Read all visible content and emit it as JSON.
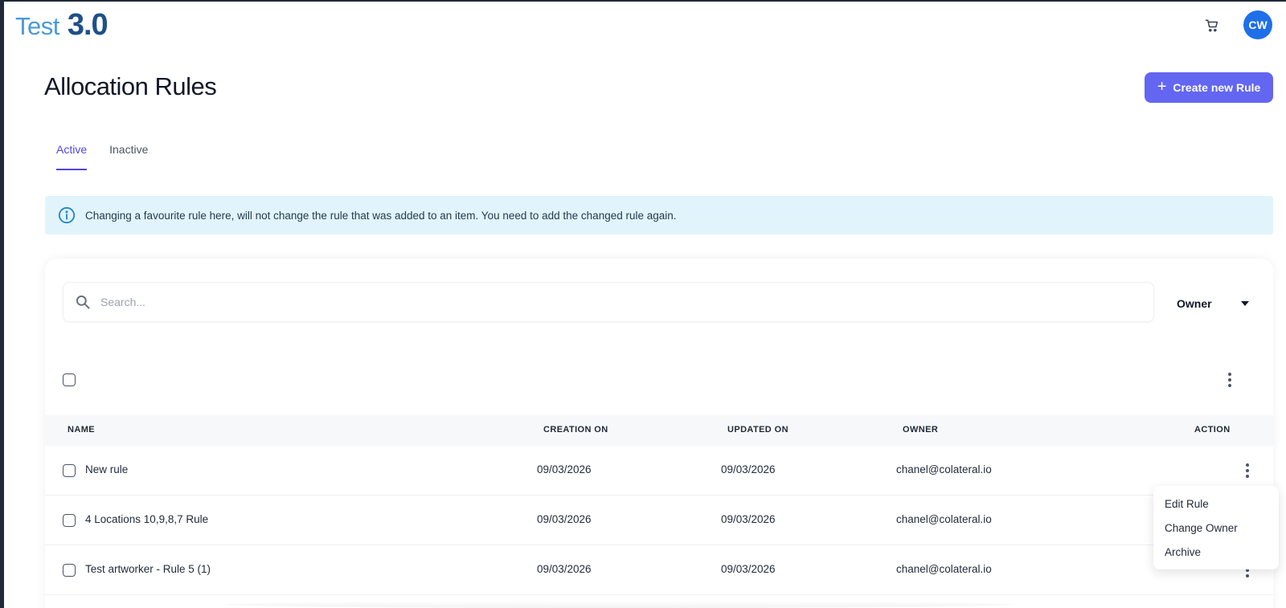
{
  "header": {
    "logo_text": "Test",
    "logo_version": "3.0",
    "avatar_initials": "CW",
    "cart_icon": "cart-icon"
  },
  "page": {
    "title": "Allocation Rules",
    "create_button_label": "Create new Rule"
  },
  "tabs": [
    {
      "label": "Active",
      "active": true
    },
    {
      "label": "Inactive",
      "active": false
    }
  ],
  "info_banner": {
    "icon": "info-icon",
    "text": "Changing a favourite rule here, will not change the rule that was added to an item. You need to add the changed rule again."
  },
  "search": {
    "placeholder": "Search...",
    "value": ""
  },
  "owner_filter": {
    "label": "Owner"
  },
  "table": {
    "columns": [
      "NAME",
      "CREATION ON",
      "UPDATED ON",
      "OWNER",
      "ACTION"
    ],
    "rows": [
      {
        "name": "New rule",
        "created": "09/03/2026",
        "updated": "09/03/2026",
        "owner": "chanel@colateral.io"
      },
      {
        "name": "4 Locations 10,9,8,7 Rule",
        "created": "09/03/2026",
        "updated": "09/03/2026",
        "owner": "chanel@colateral.io"
      },
      {
        "name": "Test artworker - Rule 5 (1)",
        "created": "09/03/2026",
        "updated": "09/03/2026",
        "owner": "chanel@colateral.io"
      }
    ]
  },
  "action_menu": {
    "items": [
      "Edit Rule",
      "Change Owner",
      "Archive"
    ]
  },
  "colors": {
    "accent": "#6366f1",
    "tab_active": "#4f46e5",
    "avatar": "#1e6fe8",
    "banner_bg": "#e2f4fb",
    "logo_light": "#4a9bd8",
    "logo_dark": "#1e4f8a"
  }
}
